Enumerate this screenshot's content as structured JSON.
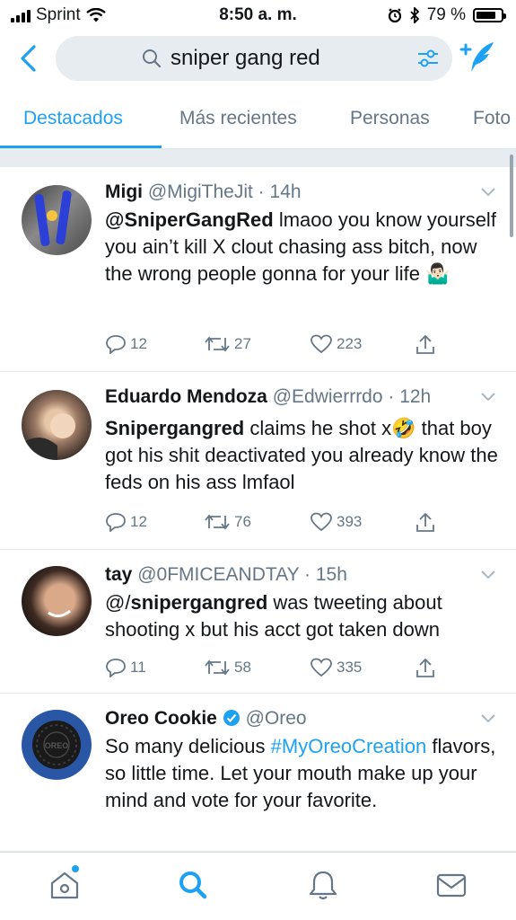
{
  "status": {
    "carrier": "Sprint",
    "time": "8:50 a. m.",
    "battery": "79 %",
    "battery_level": 0.79
  },
  "search": {
    "query": "sniper gang red"
  },
  "tabs": [
    {
      "label": "Destacados"
    },
    {
      "label": "Más recientes"
    },
    {
      "label": "Personas"
    },
    {
      "label": "Foto"
    }
  ],
  "tweets": [
    {
      "name": "Migi",
      "meta": "@MigiTheJit · 14h",
      "segments": [
        "@SniperGangRed",
        " lmaoo you know yourself you ain’t kill X clout chasing ass bitch, now the wrong people gonna for your life ",
        "🤷🏻‍♂️"
      ],
      "replies": "12",
      "retweets": "27",
      "likes": "223"
    },
    {
      "name": "Eduardo Mendoza",
      "meta": "@Edwierrrdo · 12h",
      "segments": [
        "Snipergangred",
        " claims he shot x",
        "🤣",
        " that boy got his shit deactivated you already know the feds on his ass lmfaol"
      ],
      "replies": "12",
      "retweets": "76",
      "likes": "393"
    },
    {
      "name": "tay",
      "meta": "@0FMICEANDTAY · 15h",
      "segments": [
        "@/",
        "snipergangred",
        " was tweeting about shooting x but his acct got taken down"
      ],
      "replies": "11",
      "retweets": "58",
      "likes": "335"
    },
    {
      "name": "Oreo Cookie",
      "meta": "@Oreo",
      "segments": [
        "So many delicious ",
        "#MyOreoCreation",
        " flavors, so little time. Let your mouth make up your mind and vote for your favorite."
      ],
      "avatar_text": "OREO"
    }
  ],
  "colors": {
    "accent": "#1da1f2",
    "secondary_text": "#657786",
    "divider": "#e1e8ed",
    "search_bg": "#e6ecf0"
  },
  "icons": [
    "chevron-left-icon",
    "search-icon",
    "filter-icon",
    "compose-icon",
    "reply-icon",
    "retweet-icon",
    "like-icon",
    "share-icon",
    "verified-icon",
    "home-icon",
    "explore-icon",
    "notifications-icon",
    "messages-icon"
  ]
}
